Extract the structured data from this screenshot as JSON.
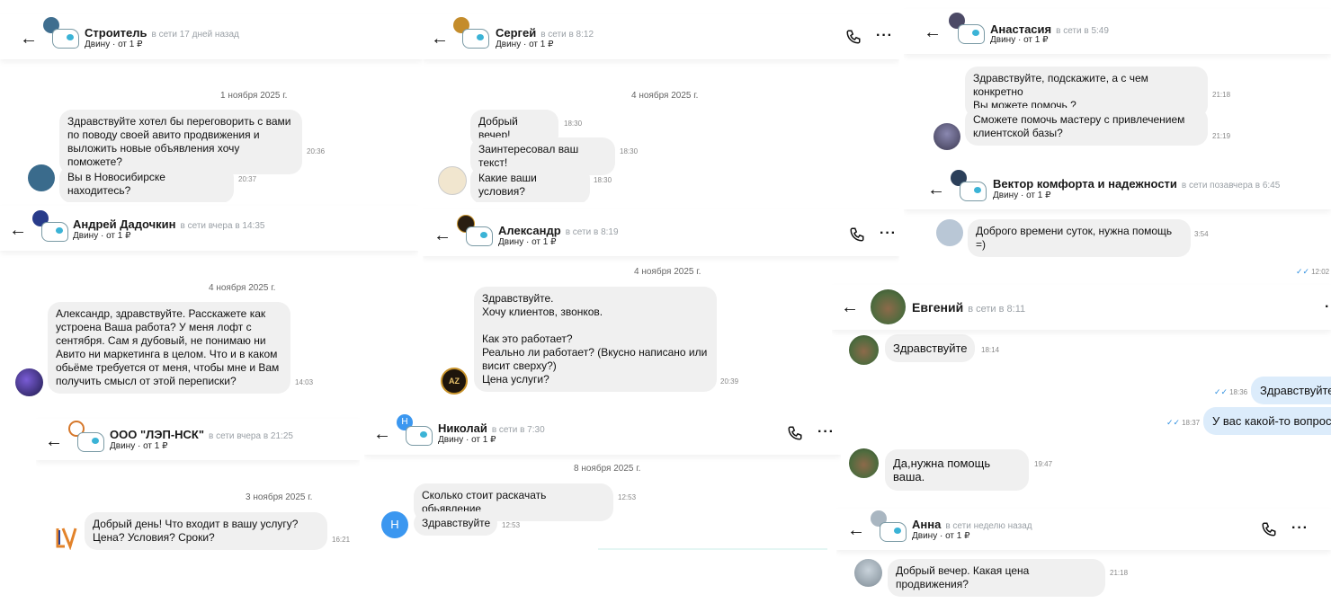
{
  "common": {
    "subtitle": "Двину · от 1 ₽"
  },
  "colors": {
    "bubble_in": "#f0f0f0",
    "bubble_out": "#dcecfb",
    "read_ticks": "#2f8fe0",
    "status_text": "#9aa0a6"
  },
  "chats": {
    "stroitel": {
      "name": "Строитель",
      "status": "в сети 17 дней назад",
      "date": "1 ноября 2025 г.",
      "messages": [
        {
          "text": "Здравствуйте хотел бы переговорить с вами\nпо поводу своей авито продвижения и\nвыложить новые объявления хочу поможете?",
          "time": "20:36"
        },
        {
          "text": "Вы в Новосибирске находитесь?",
          "time": "20:37"
        }
      ]
    },
    "dadochkin": {
      "name": "Андрей Дадочкин",
      "status": "в сети вчера в 14:35",
      "date": "4 ноября 2025 г.",
      "messages": [
        {
          "text": "Александр, здравствуйте. Расскажете как\nустроена Ваша работа? У меня лофт с\nсентября. Сам я дубовый, не понимаю ни\nАвито ни маркетинга в целом. Что и в каком\nобьёме требуется от меня, чтобы мне и Вам\nполучить смысл от этой переписки?",
          "time": "14:03"
        }
      ]
    },
    "lep": {
      "name": "ООО \"ЛЭП-НСК\"",
      "status": "в сети вчера в 21:25",
      "date": "3 ноября 2025 г.",
      "messages": [
        {
          "text": "Добрый день! Что входит в вашу услугу?\nЦена? Условия? Сроки?",
          "time": "16:21"
        }
      ]
    },
    "sergey": {
      "name": "Сергей",
      "status": "в сети в 8:12",
      "date": "4 ноября 2025 г.",
      "messages": [
        {
          "text": "Добрый вечер!",
          "time": "18:30"
        },
        {
          "text": "Заинтересовал ваш текст!",
          "time": "18:30"
        },
        {
          "text": "Какие ваши условия?",
          "time": "18:30"
        }
      ]
    },
    "alexandr": {
      "name": "Александр",
      "status": "в сети в 8:19",
      "date": "4 ноября 2025 г.",
      "messages": [
        {
          "text": "Здравствуйте.\nХочу клиентов, звонков.\n\nКак это работает?\nРеально ли работает? (Вкусно написано или\nвисит сверху?)\n Цена услуги?",
          "time": "20:39"
        }
      ],
      "avatar_text": "AZ"
    },
    "nikolay": {
      "name": "Николай",
      "status": "в сети в 7:30",
      "date": "8 ноября 2025 г.",
      "avatar_letter": "Н",
      "messages": [
        {
          "text": "Сколько стоит раскачать обьявление",
          "time": "12:53"
        },
        {
          "text": "Здравствуйте",
          "time": "12:53"
        }
      ]
    },
    "anastasia": {
      "name": "Анастасия",
      "status": "в сети в 5:49",
      "messages": [
        {
          "text": "Здравствуйте, подскажите, а с чем конкретно\nВы можете помочь ?",
          "time": "21:18"
        },
        {
          "text": "Сможете помочь мастеру с привлечением\nклиентской базы?",
          "time": "21:19"
        }
      ]
    },
    "vektor": {
      "name": "Вектор комфорта и надежности",
      "status": "в сети позавчера в 6:45",
      "messages": [
        {
          "text": "Доброго времени суток, нужна помощь =)",
          "time": "3:54"
        }
      ],
      "outgoing_time": "12:02"
    },
    "evgeniy": {
      "name": "Евгений",
      "status": "в сети в 8:11",
      "messages": [
        {
          "text": "Здравствуйте",
          "time": "18:14",
          "dir": "in"
        },
        {
          "text": "Здравствуйте",
          "time": "18:36",
          "dir": "out"
        },
        {
          "text": "У вас какой-то вопрос?",
          "time": "18:37",
          "dir": "out"
        },
        {
          "text": "Да,нужна помощь ваша.",
          "time": "19:47",
          "dir": "in"
        }
      ]
    },
    "anna": {
      "name": "Анна",
      "status": "в сети неделю назад",
      "messages": [
        {
          "text": "Добрый вечер. Какая цена продвижения?",
          "time": "21:18"
        }
      ]
    }
  }
}
